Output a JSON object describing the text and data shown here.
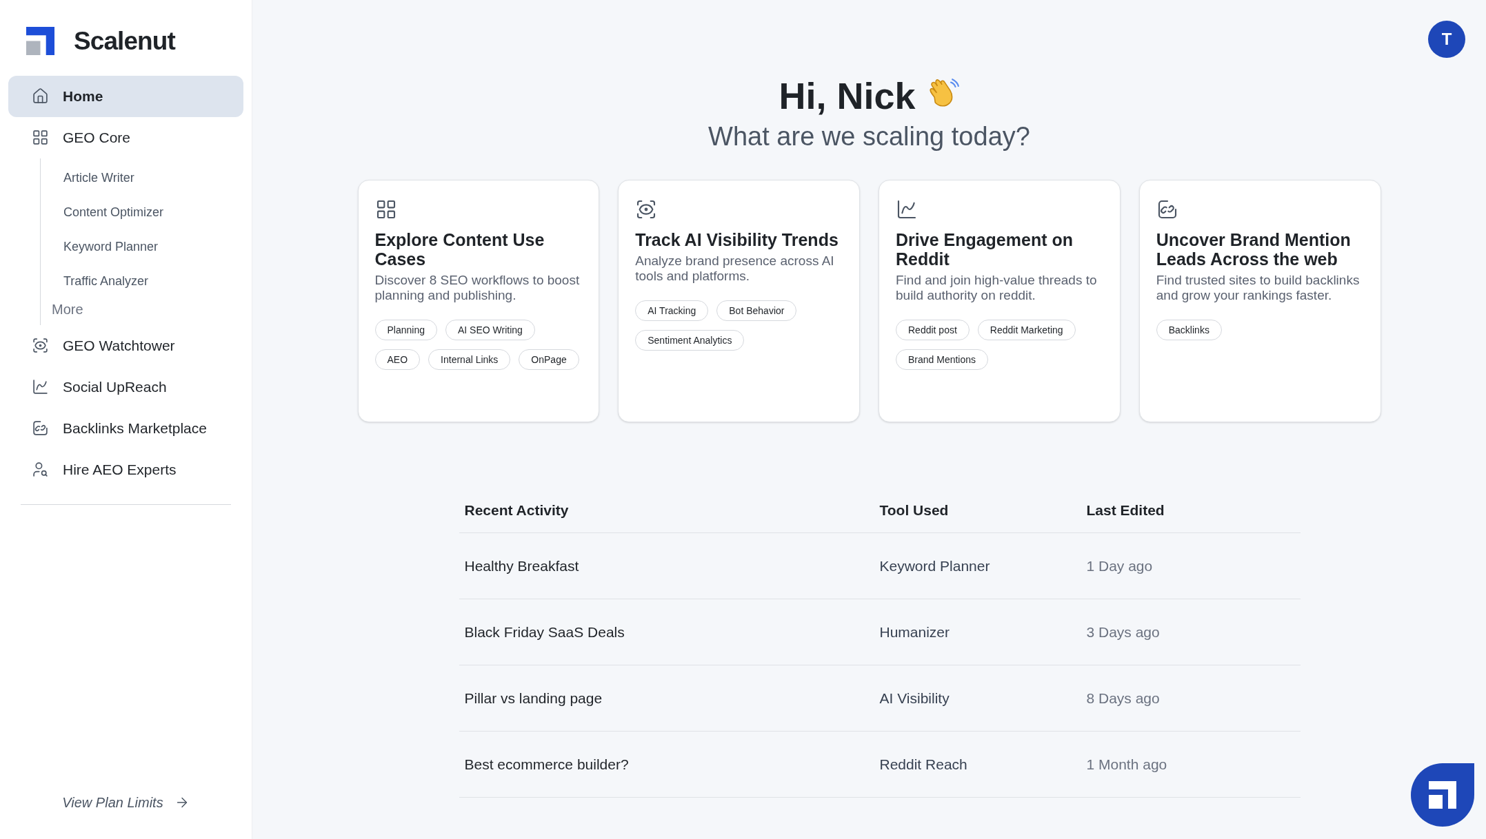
{
  "brand": {
    "name": "Scalenut"
  },
  "nav": [
    {
      "label": "Home",
      "selected": true
    },
    {
      "label": "GEO Core",
      "selected": false,
      "children": [
        {
          "label": "Article Writer"
        },
        {
          "label": "Content Optimizer"
        },
        {
          "label": "Keyword Planner"
        },
        {
          "label": "Traffic Analyzer"
        }
      ],
      "more": "More"
    },
    {
      "label": "GEO Watchtower",
      "selected": false
    },
    {
      "label": "Social UpReach",
      "selected": false
    },
    {
      "label": "Backlinks Marketplace",
      "selected": false
    },
    {
      "label": "Hire AEO Experts",
      "selected": false
    }
  ],
  "plan_link": "View Plan Limits",
  "avatar": "T",
  "greeting": {
    "title": "Hi, Nick",
    "subtitle": "What are we scaling today?"
  },
  "cards": [
    {
      "title": "Explore Content Use Cases",
      "description": "Discover 8 SEO workflows to boost planning and publishing.",
      "tags": [
        "Planning",
        "AI SEO Writing",
        "AEO",
        "Internal Links",
        "OnPage"
      ]
    },
    {
      "title": "Track AI Visibility Trends",
      "description": "Analyze brand presence across AI tools and platforms.",
      "tags": [
        "AI Tracking",
        "Bot Behavior",
        "Sentiment Analytics"
      ]
    },
    {
      "title": "Drive Engagement on Reddit",
      "description": "Find and join high-value threads to build authority on reddit.",
      "tags": [
        "Reddit post",
        "Reddit Marketing",
        "Brand Mentions"
      ]
    },
    {
      "title": "Uncover Brand Mention Leads Across the web",
      "description": "Find trusted sites to build backlinks and grow your rankings faster.",
      "tags": [
        "Backlinks"
      ]
    }
  ],
  "table": {
    "columns": [
      "Recent Activity",
      "Tool Used",
      "Last Edited"
    ],
    "rows": [
      [
        "Healthy Breakfast",
        "Keyword Planner",
        "1 Day ago"
      ],
      [
        "Black Friday SaaS Deals",
        "Humanizer",
        "3 Days ago"
      ],
      [
        "Pillar vs landing page",
        "AI Visibility",
        "8 Days ago"
      ],
      [
        "Best ecommerce builder?",
        "Reddit Reach",
        "1 Month ago"
      ]
    ]
  }
}
